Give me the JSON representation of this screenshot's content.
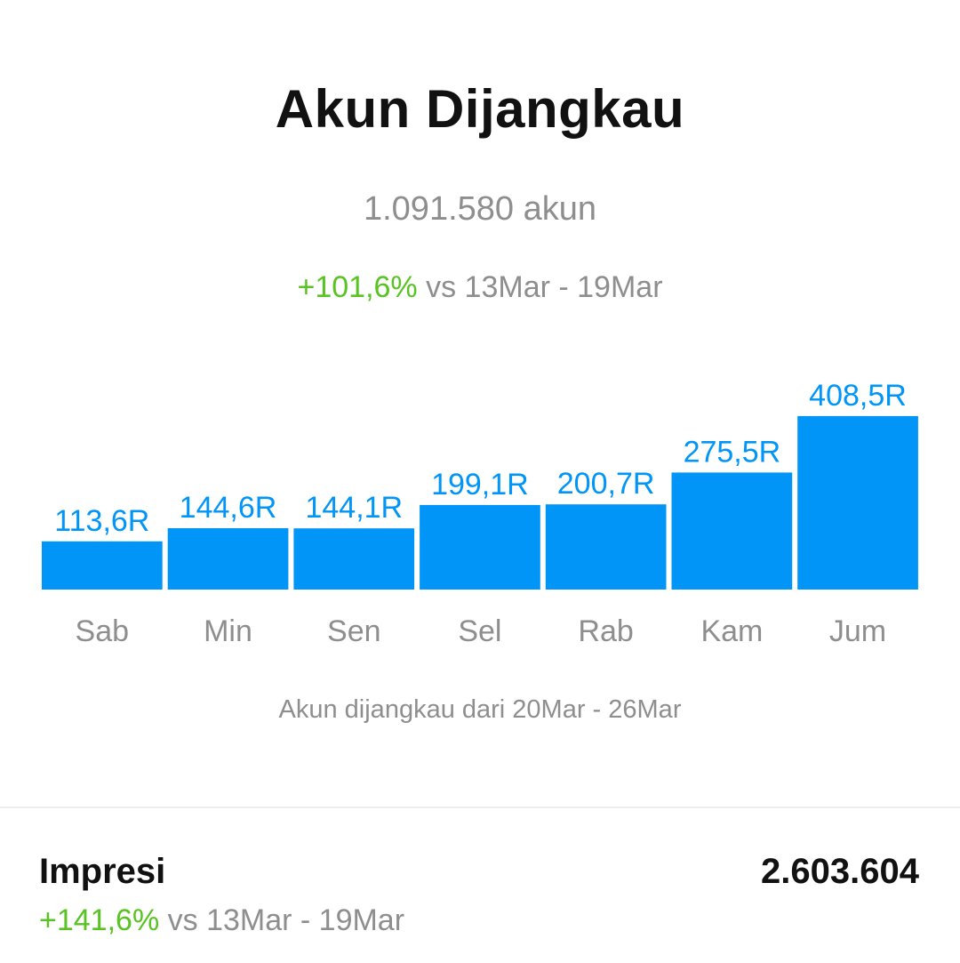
{
  "header": {
    "title": "Akun Dijangkau",
    "total": "1.091.580 akun",
    "change_pct": "+101,6%",
    "change_period": "vs 13Mar - 19Mar"
  },
  "chart_data": {
    "type": "bar",
    "categories": [
      "Sab",
      "Min",
      "Sen",
      "Sel",
      "Rab",
      "Kam",
      "Jum"
    ],
    "values": [
      113.6,
      144.6,
      144.1,
      199.1,
      200.7,
      275.5,
      408.5
    ],
    "value_labels": [
      "113,6R",
      "144,6R",
      "144,1R",
      "199,1R",
      "200,7R",
      "275,5R",
      "408,5R"
    ],
    "bar_color": "#0095f6",
    "grid": false
  },
  "caption": "Akun dijangkau dari 20Mar - 26Mar",
  "impressions": {
    "label": "Impresi",
    "value": "2.603.604",
    "change_pct": "+141,6%",
    "change_period": "vs 13Mar - 19Mar"
  },
  "colors": {
    "accent_blue": "#0095f6",
    "positive_green": "#58c322",
    "muted_text": "#8e8e8e"
  }
}
